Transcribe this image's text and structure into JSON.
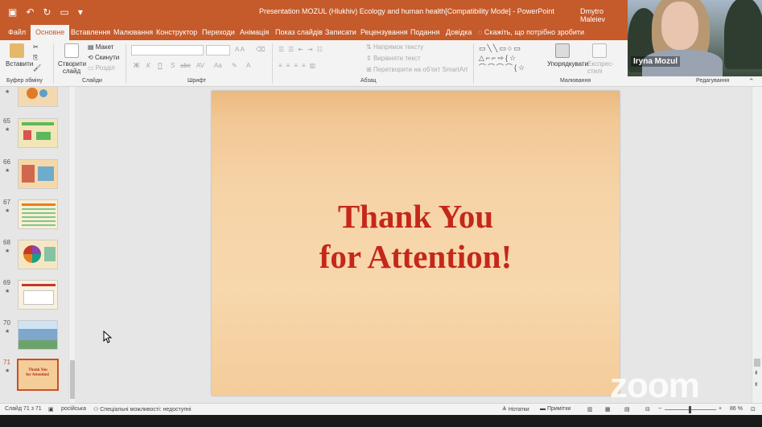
{
  "window": {
    "title": "Presentation MOZUL (Hlukhiv) Ecology and human health[Compatibility Mode] - PowerPoint",
    "user": "Dmytro Maleiev"
  },
  "tabs": [
    "Файл",
    "Основне",
    "Вставлення",
    "Малювання",
    "Конструктор",
    "Переходи",
    "Анімація",
    "Показ слайдів",
    "Записати",
    "Рецензування",
    "Подання",
    "Довідка"
  ],
  "active_tab": "Основне",
  "tell_me": "Скажіть, що потрібно зробити",
  "ribbon": {
    "paste": "Вставити",
    "cut": "✂",
    "copy": "⎘",
    "format_painter": "🖌",
    "new_slide": "Створити слайд",
    "layout": "Макет",
    "reset": "Скинути",
    "section": "Розділ",
    "bold": "Ж",
    "italic": "К",
    "underline": "П",
    "shadow": "S",
    "strike": "abc",
    "spacing": "AV",
    "text_direction": "Напрямок тексту",
    "align_text": "Вирівняти текст",
    "smartart": "Перетворити на об'єкт SmartArt",
    "arrange": "Упорядкувати",
    "quick_styles": "Експрес-стилі",
    "groups": {
      "clipboard": "Буфер обміну",
      "slides": "Слайди",
      "font": "Шрифт",
      "paragraph": "Абзац",
      "drawing": "Малювання",
      "editing": "Редагування"
    }
  },
  "video": {
    "participant": "Iryna Mozul"
  },
  "thumbnails": [
    {
      "num": "",
      "star": "★",
      "colors": [
        "#f4d9b0",
        "#e07a2b",
        "#5aa0c8"
      ]
    },
    {
      "num": "65",
      "star": "★",
      "colors": [
        "#f2e6b8",
        "#5cb85c",
        "#d9534f"
      ]
    },
    {
      "num": "66",
      "star": "★",
      "colors": [
        "#f5d8a8",
        "#c0392b",
        "#3498db"
      ]
    },
    {
      "num": "67",
      "star": "★",
      "colors": [
        "#fbeed3",
        "#e67e22",
        "#27ae60"
      ]
    },
    {
      "num": "68",
      "star": "★",
      "colors": [
        "#f6e7c4",
        "#8e44ad",
        "#16a085"
      ]
    },
    {
      "num": "69",
      "star": "★",
      "colors": [
        "#f8f0dc",
        "#7f8c8d",
        "#bdc3c7"
      ]
    },
    {
      "num": "70",
      "star": "★",
      "colors": [
        "#cfe4f2",
        "#4a7fb5",
        "#6ca36c"
      ]
    },
    {
      "num": "71",
      "star": "★",
      "colors": [
        "#f5cd98",
        "#c4281a",
        "#c4281a"
      ]
    }
  ],
  "selected_thumb_text": {
    "line1": "Thank You",
    "line2": "for Attention!"
  },
  "slide": {
    "line1": "Thank You",
    "line2": "for Attention!",
    "text_color": "#c4281a"
  },
  "status": {
    "slide_info": "Слайд 71 з 71",
    "language": "російська",
    "accessibility": "Спеціальні можливості: недоступні",
    "notes": "Нотатки",
    "comments": "Примітки",
    "zoom": "86 %"
  },
  "watermark": "zoom"
}
